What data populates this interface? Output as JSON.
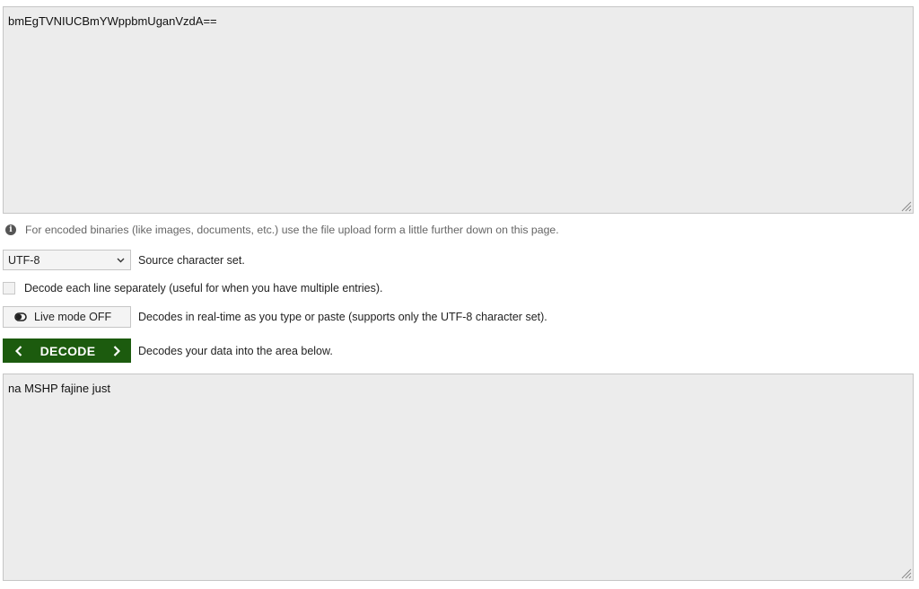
{
  "input": {
    "value": "bmEgTVNIUCBmYWppbmUganVzdA=="
  },
  "info": {
    "icon": "info-icon",
    "text": "For encoded binaries (like images, documents, etc.) use the file upload form a little further down on this page."
  },
  "charset": {
    "selected": "UTF-8",
    "label": "Source character set."
  },
  "line_option": {
    "checked": false,
    "label": "Decode each line separately (useful for when you have multiple entries)."
  },
  "live_mode": {
    "button_label": "Live mode OFF",
    "description": "Decodes in real-time as you type or paste (supports only the UTF-8 character set)."
  },
  "decode": {
    "button_label": "DECODE",
    "description": "Decodes your data into the area below."
  },
  "output": {
    "value": "na MSHP fajine just"
  }
}
